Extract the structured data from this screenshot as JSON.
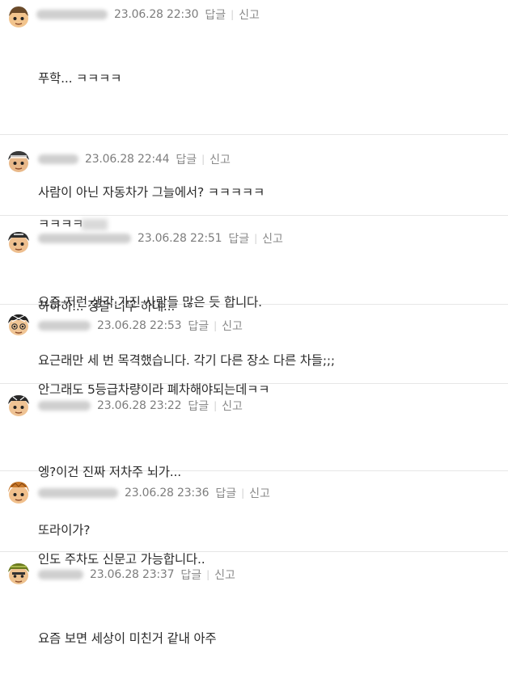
{
  "comments": [
    {
      "date": "23.06.28 22:30",
      "reply_label": "답글",
      "report_label": "신고",
      "lines": [
        "푸학... ㅋㅋㅋㅋ",
        "",
        "사람이 아닌 자동차가 그늘에서? ㅋㅋㅋㅋㅋ",
        "",
        "하하하... 정말 너무 하네..."
      ]
    },
    {
      "date": "23.06.28 22:44",
      "reply_label": "답글",
      "report_label": "신고",
      "lines": [
        "ㅋㅋㅋㅋ"
      ]
    },
    {
      "date": "23.06.28 22:51",
      "reply_label": "답글",
      "report_label": "신고",
      "lines": [
        "요즘 저런 생각 가진 사람들 많은 듯 합니다.",
        "요근래만 세 번 목격했습니다. 각기 다른 장소 다른 차들;;;"
      ]
    },
    {
      "date": "23.06.28 22:53",
      "reply_label": "답글",
      "report_label": "신고",
      "lines": [
        "안그래도 5등급차량이라 폐차해야되는데ㅋㅋ"
      ]
    },
    {
      "date": "23.06.28 23:22",
      "reply_label": "답글",
      "report_label": "신고",
      "lines": [
        "엥?이건 진짜 저차주 뇌가...",
        "또라이가?"
      ]
    },
    {
      "date": "23.06.28 23:36",
      "reply_label": "답글",
      "report_label": "신고",
      "lines": [
        "인도 주차도 신문고 가능합니다.."
      ]
    },
    {
      "date": "23.06.28 23:37",
      "reply_label": "답글",
      "report_label": "신고",
      "lines": [
        "요즘 보면 세상이 미친거 같내 아주"
      ]
    }
  ]
}
